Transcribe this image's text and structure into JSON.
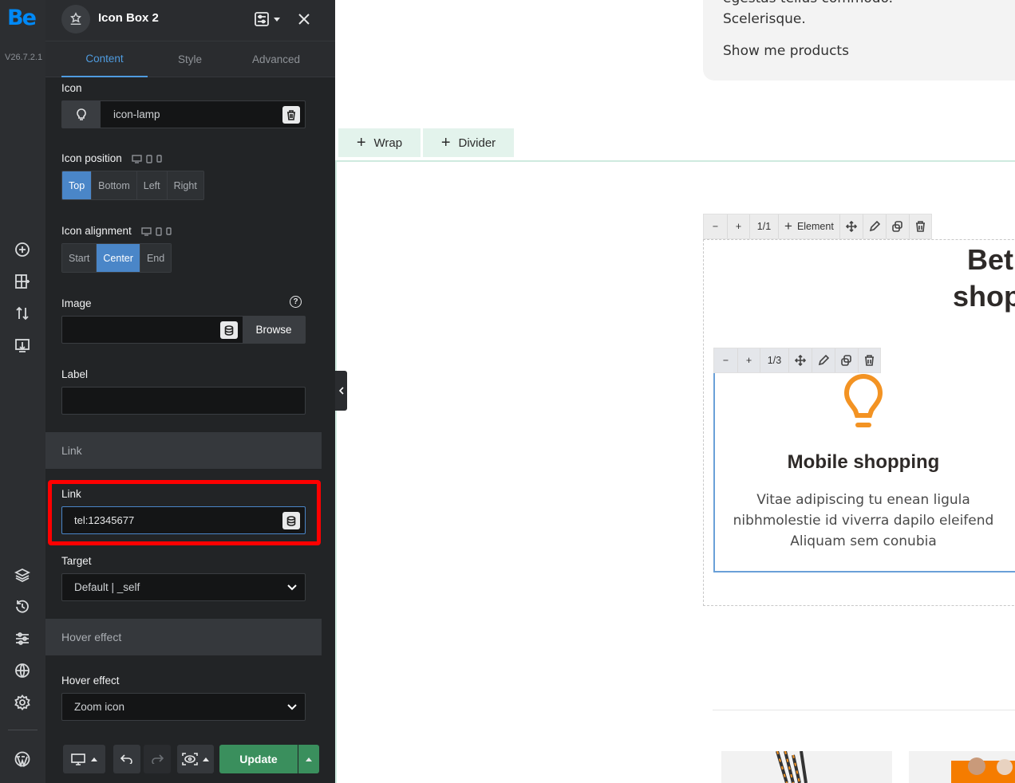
{
  "rail": {
    "logo": "Be",
    "version": "V26.7.2.1",
    "icons": [
      "add-icon",
      "layout-add-icon",
      "sort-icon",
      "import-icon",
      "layers-icon",
      "history-icon",
      "sliders-icon",
      "globe-icon",
      "settings-icon",
      "wordpress-icon"
    ]
  },
  "panel": {
    "title": "Icon Box 2",
    "tabs": [
      "Content",
      "Style",
      "Advanced"
    ],
    "active_tab": "Content",
    "icon": {
      "label": "Icon",
      "value": "icon-lamp"
    },
    "icon_position": {
      "label": "Icon position",
      "options": [
        "Top",
        "Bottom",
        "Left",
        "Right"
      ],
      "selected": "Top"
    },
    "icon_alignment": {
      "label": "Icon alignment",
      "options": [
        "Start",
        "Center",
        "End"
      ],
      "selected": "Center"
    },
    "image": {
      "label": "Image",
      "value": "",
      "browse": "Browse"
    },
    "label_field": {
      "label": "Label",
      "value": ""
    },
    "link_section": "Link",
    "link": {
      "label": "Link",
      "value": "tel:12345677"
    },
    "target": {
      "label": "Target",
      "value": "Default | _self"
    },
    "hover_section": "Hover effect",
    "hover": {
      "label": "Hover effect",
      "value": "Zoom icon"
    },
    "footer": {
      "update": "Update"
    }
  },
  "canvas": {
    "top_card": {
      "line1": "egestas tellus commodo.",
      "line2": "Scelerisque.",
      "link": "Show me products"
    },
    "wrap_label": "Wrap",
    "divider_label": "Divider",
    "wrap_toolbar": {
      "count": "1/1",
      "element": "Element"
    },
    "heading_line1": "Betl",
    "heading_line2": "shop",
    "item_toolbar": {
      "count": "1/3"
    },
    "iconbox": {
      "title": "Mobile shopping",
      "text1": "Vitae adipiscing tu enean ligula",
      "text2": "nibhmolestie id viverra dapilo eleifend",
      "text3": "Aliquam sem conubia"
    }
  },
  "colors": {
    "accent": "#4a86c8",
    "highlight": "#ff0000",
    "update": "#3a8f5d",
    "icon_orange": "#f39323"
  }
}
